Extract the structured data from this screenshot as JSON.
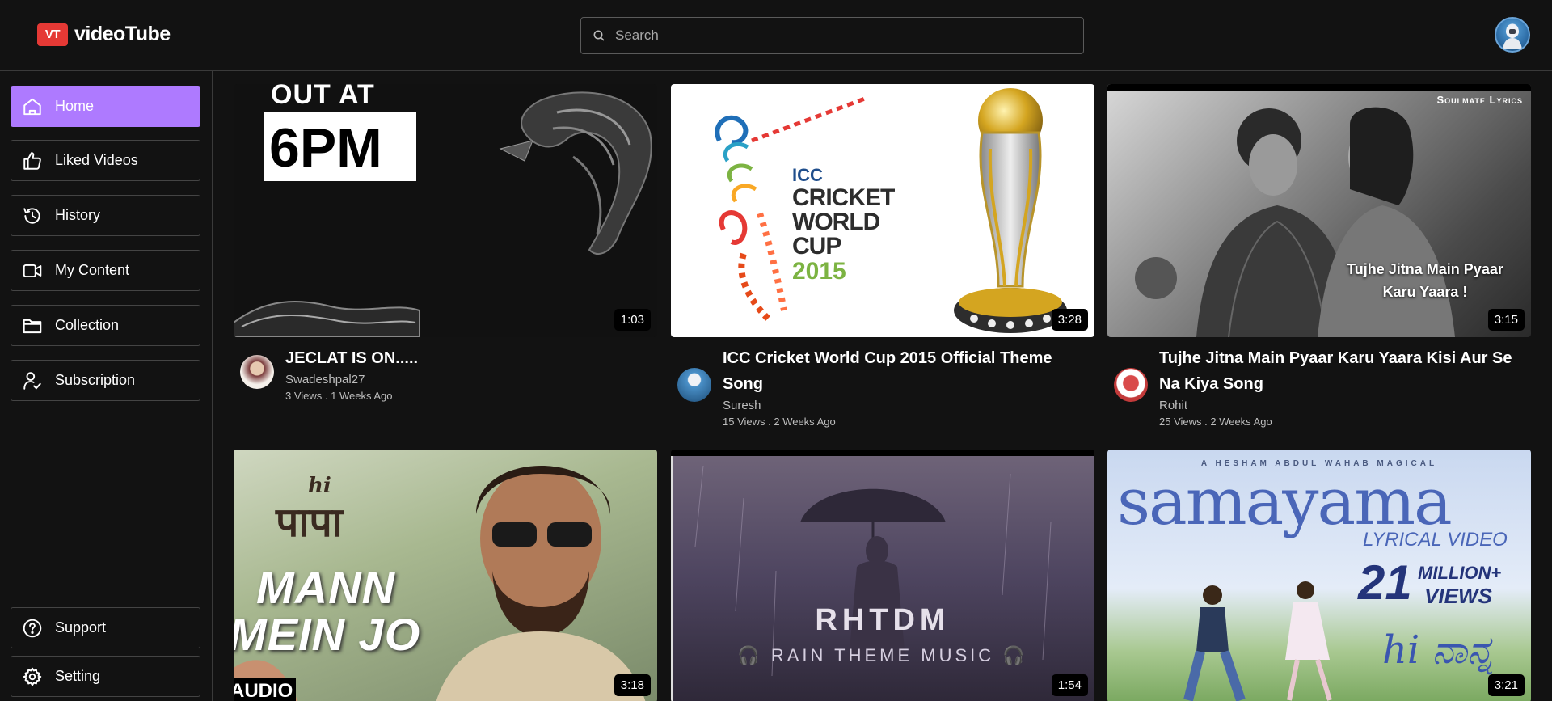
{
  "app": {
    "logo_badge": "VT",
    "logo_text": "videoTube"
  },
  "search": {
    "placeholder": "Search"
  },
  "sidebar": {
    "items": [
      {
        "label": "Home",
        "icon": "home-icon",
        "active": true
      },
      {
        "label": "Liked Videos",
        "icon": "thumbs-up-icon"
      },
      {
        "label": "History",
        "icon": "history-icon"
      },
      {
        "label": "My Content",
        "icon": "video-camera-icon"
      },
      {
        "label": "Collection",
        "icon": "folder-icon"
      },
      {
        "label": "Subscription",
        "icon": "user-check-icon"
      }
    ],
    "bottom_items": [
      {
        "label": "Support",
        "icon": "help-circle-icon"
      },
      {
        "label": "Setting",
        "icon": "gear-icon"
      }
    ]
  },
  "videos": [
    {
      "title": "JECLAT IS ON.....",
      "channel": "Swadeshpal27",
      "stats": "3 Views . 1 Weeks Ago",
      "duration": "1:03",
      "thumb_text": {
        "line1": "OUT AT",
        "line2": "6PM"
      }
    },
    {
      "title": "ICC Cricket World Cup 2015 Official Theme Song",
      "channel": "Suresh",
      "stats": "15 Views . 2 Weeks Ago",
      "duration": "3:28",
      "thumb_text": {
        "logo_top": "ICC",
        "logo_line1": "CRICKET",
        "logo_line2": "WORLD",
        "logo_line3": "CUP",
        "logo_year": "2015"
      }
    },
    {
      "title": "Tujhe Jitna Main Pyaar Karu Yaara Kisi Aur Se Na Kiya Song",
      "channel": "Rohit",
      "stats": "25 Views . 2 Weeks Ago",
      "duration": "3:15",
      "thumb_text": {
        "corner": "Soulmate Lyrics",
        "overlay1": "Tujhe Jitna Main Pyaar",
        "overlay2": "Karu Yaara !"
      }
    },
    {
      "title": "",
      "channel": "",
      "stats": "",
      "duration": "3:18",
      "thumb_text": {
        "title_small": "hi",
        "title_big": "पापा",
        "line1": "MANN",
        "line2": "MEIN JO",
        "tag": "AUDIO"
      }
    },
    {
      "title": "",
      "channel": "",
      "stats": "",
      "duration": "1:54",
      "thumb_text": {
        "big": "RHTDM",
        "sub": "RAIN THEME MUSIC"
      }
    },
    {
      "title": "",
      "channel": "",
      "stats": "",
      "duration": "3:21",
      "thumb_text": {
        "top": "A HESHAM ABDUL WAHAB MAGICAL",
        "big": "samayama",
        "sub": "LYRICAL VIDEO",
        "count": "21",
        "count_label1": "MILLION+",
        "count_label2": "VIEWS",
        "script": "hi ನಾನ್ನ"
      }
    }
  ],
  "colors": {
    "accent": "#ae7aff",
    "brand": "#e53935",
    "background": "#121212"
  }
}
